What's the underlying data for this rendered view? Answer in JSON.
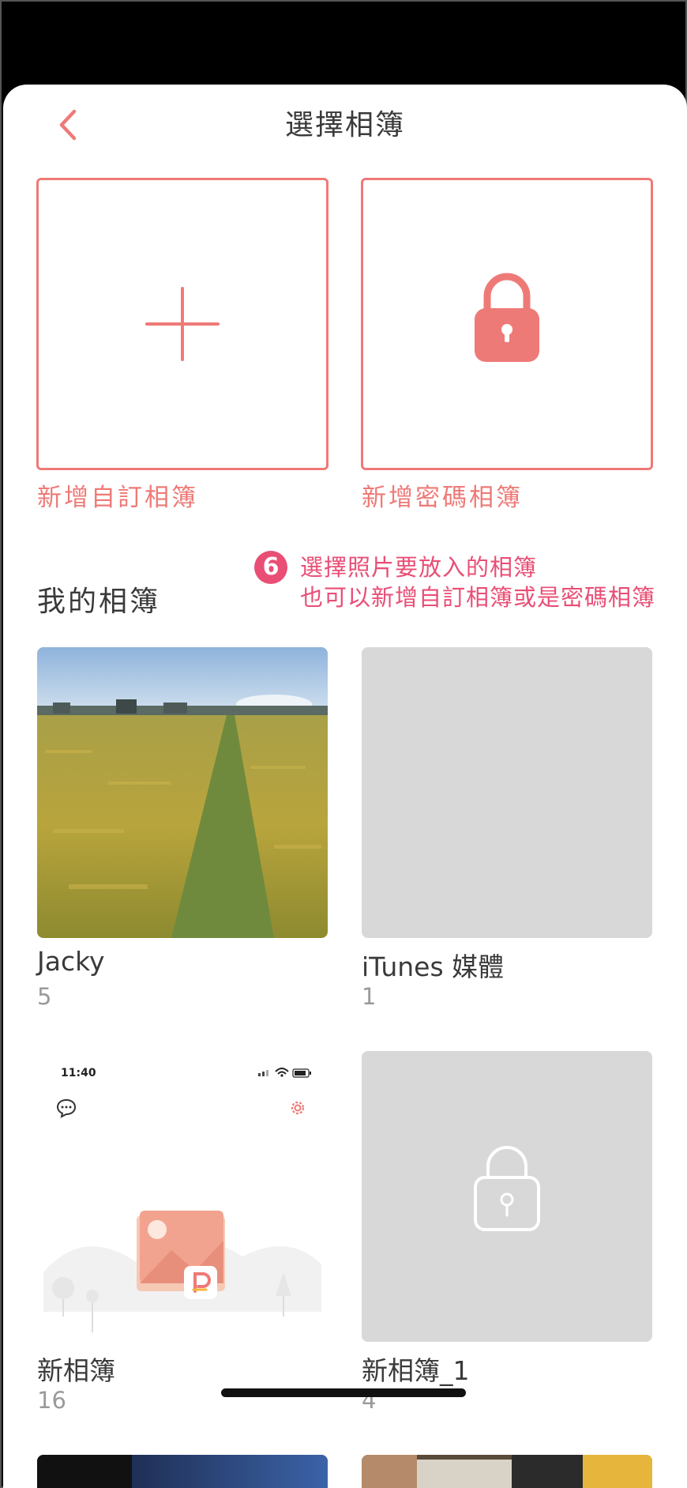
{
  "nav": {
    "title": "選擇相簿",
    "back_icon": "chevron-left-icon"
  },
  "create_tiles": [
    {
      "label": "新增自訂相簿",
      "icon": "plus-icon"
    },
    {
      "label": "新增密碼相簿",
      "icon": "lock-icon"
    }
  ],
  "section": {
    "title": "我的相簿"
  },
  "annotation": {
    "badge": "6",
    "line1": "選擇照片要放入的相簿",
    "line2": "也可以新增自訂相簿或是密碼相簿"
  },
  "albums": [
    {
      "name": "Jacky",
      "count": "5"
    },
    {
      "name": "iTunes 媒體",
      "count": "1"
    },
    {
      "name": "新相簿",
      "count": "16"
    },
    {
      "name": "新相簿_1",
      "count": "4"
    }
  ],
  "screenshot_thumb": {
    "time": "11:40"
  },
  "colors": {
    "accent": "#ee7a77",
    "annotation": "#e94e75",
    "placeholder_gray": "#d8d8d8",
    "text_primary": "#3a3a3a",
    "text_secondary": "#9a9a9a"
  }
}
